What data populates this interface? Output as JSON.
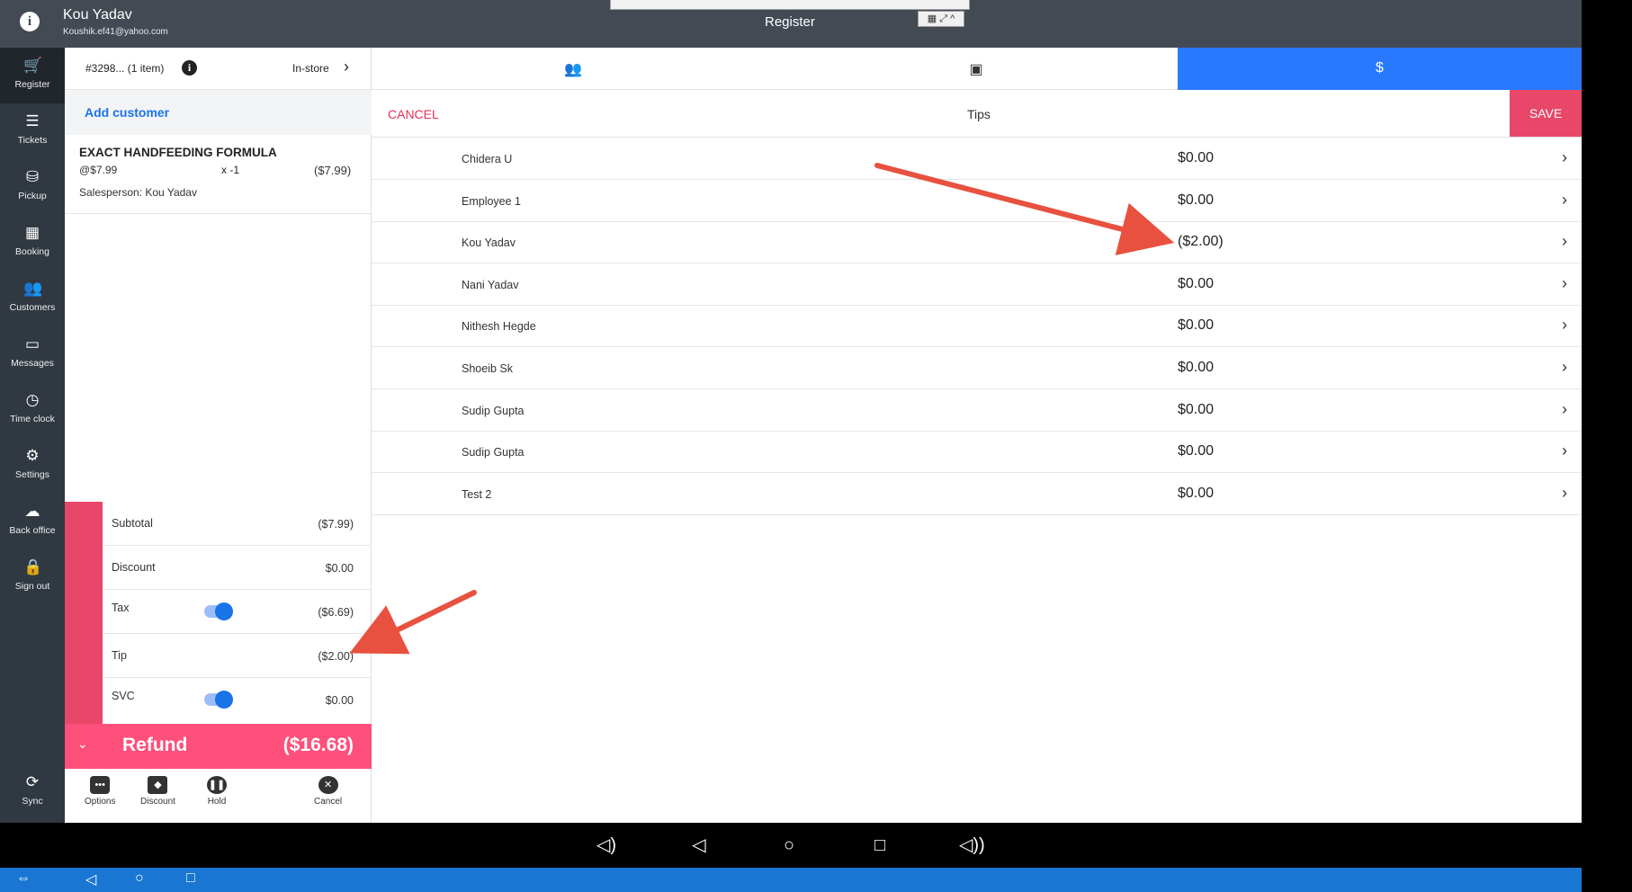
{
  "header": {
    "user_name": "Kou Yadav",
    "user_email": "Koushik.ef41@yahoo.com",
    "title": "Register"
  },
  "nav": [
    {
      "label": "Register",
      "icon": "cart-icon",
      "glyph": "🛒"
    },
    {
      "label": "Tickets",
      "icon": "tickets-icon",
      "glyph": "☰"
    },
    {
      "label": "Pickup",
      "icon": "pickup-icon",
      "glyph": "⛁"
    },
    {
      "label": "Booking",
      "icon": "calendar-icon",
      "glyph": "▦"
    },
    {
      "label": "Customers",
      "icon": "people-icon",
      "glyph": "👥"
    },
    {
      "label": "Messages",
      "icon": "message-icon",
      "glyph": "▭"
    },
    {
      "label": "Time clock",
      "icon": "clock-icon",
      "glyph": "◷"
    },
    {
      "label": "Settings",
      "icon": "gear-icon",
      "glyph": "⚙"
    },
    {
      "label": "Back office",
      "icon": "cloud-icon",
      "glyph": "☁"
    },
    {
      "label": "Sign out",
      "icon": "lock-icon",
      "glyph": "🔒"
    },
    {
      "label": "Sync",
      "icon": "sync-icon",
      "glyph": "⟳"
    }
  ],
  "ticket": {
    "number": "#3298... (1 item)",
    "mode": "In-store",
    "add_customer": "Add customer",
    "item": {
      "name": "EXACT HANDFEEDING FORMULA",
      "price": "@$7.99",
      "qty": "x  -1",
      "amount": "($7.99)",
      "salesperson": "Salesperson: Kou Yadav"
    },
    "totals": {
      "subtotal_label": "Subtotal",
      "subtotal": "($7.99)",
      "discount_label": "Discount",
      "discount": "$0.00",
      "tax_label": "Tax",
      "tax": "($6.69)",
      "tip_label": "Tip",
      "tip": "($2.00)",
      "svc_label": "SVC",
      "svc": "$0.00"
    },
    "refund_label": "Refund",
    "refund_value": "($16.68)",
    "actions": {
      "options": "Options",
      "discount": "Discount",
      "hold": "Hold",
      "cancel": "Cancel"
    }
  },
  "main": {
    "tabs": {
      "people_glyph": "👥",
      "photo_glyph": "▣",
      "dollar": "$"
    },
    "cancel": "CANCEL",
    "title": "Tips",
    "save": "SAVE",
    "tips": [
      {
        "employee": "Chidera U",
        "amount": "$0.00"
      },
      {
        "employee": "Employee 1",
        "amount": "$0.00"
      },
      {
        "employee": "Kou Yadav",
        "amount": "($2.00)"
      },
      {
        "employee": "Nani Yadav",
        "amount": "$0.00"
      },
      {
        "employee": "Nithesh Hegde",
        "amount": "$0.00"
      },
      {
        "employee": "Shoeib Sk",
        "amount": "$0.00"
      },
      {
        "employee": "Sudip Gupta",
        "amount": "$0.00"
      },
      {
        "employee": "Sudip Gupta",
        "amount": "$0.00"
      },
      {
        "employee": "Test 2",
        "amount": "$0.00"
      }
    ]
  },
  "colors": {
    "accent_pink": "#e8476a",
    "refund_pink": "#ff4f7b",
    "tab_blue": "#2979ff",
    "link_blue": "#1a73e8",
    "annotation_red": "#e8513f"
  }
}
